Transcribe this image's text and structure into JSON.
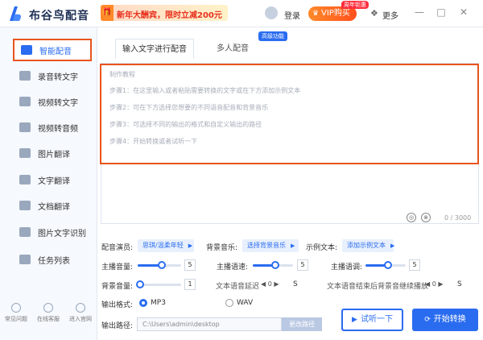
{
  "app": {
    "title": "布谷鸟配音",
    "promo_text": "新年大酬宾，限时立减200元",
    "login_label": "登录",
    "vip_label": "VIP购买",
    "vip_badge": "周年钜惠",
    "more_label": "更多",
    "window_controls": [
      "—",
      "□",
      "✕"
    ]
  },
  "sidebar": {
    "items": [
      {
        "label": "智能配音",
        "icon": "mic-icon",
        "active": true
      },
      {
        "label": "录音转文字",
        "icon": "recording-icon"
      },
      {
        "label": "视频转文字",
        "icon": "video-icon"
      },
      {
        "label": "视频转音频",
        "icon": "video-audio-icon"
      },
      {
        "label": "图片翻译",
        "icon": "image-icon"
      },
      {
        "label": "文字翻译",
        "icon": "translate-icon"
      },
      {
        "label": "文档翻译",
        "icon": "document-icon"
      },
      {
        "label": "图片文字识别",
        "icon": "ocr-icon"
      },
      {
        "label": "任务列表",
        "icon": "task-icon"
      }
    ],
    "footer": [
      {
        "label": "常见问题",
        "icon": "help-icon"
      },
      {
        "label": "在线客服",
        "icon": "support-icon"
      },
      {
        "label": "进入官网",
        "icon": "home-icon"
      }
    ]
  },
  "tabs": {
    "single": "输入文字进行配音",
    "multi": "多人配音",
    "multi_badge": "高级功能"
  },
  "editor": {
    "heading": "制作教程",
    "steps": [
      "步骤1：在这里输入或者粘贴需要转换的文字或在下方添加示例文本",
      "步骤2：可在下方选择您想要的不同语音配音和背景音乐",
      "步骤3：可选择不同的输出的格式和自定义输出的路径",
      "步骤4：开始转换或者试听一下"
    ],
    "counter": "0 / 3000"
  },
  "settings": {
    "voice_label": "配音演员:",
    "voice_value": "思琪/温柔年轻",
    "bgm_label": "背景音乐:",
    "bgm_value": "选择背景音乐",
    "sample_label": "示例文本:",
    "sample_value": "添加示例文本",
    "main_volume_label": "主播音量:",
    "main_volume_value": "5",
    "main_volume_level": 0.55,
    "main_speed_label": "主播语速:",
    "main_speed_value": "5",
    "main_speed_level": 0.55,
    "main_pitch_label": "主播语调:",
    "main_pitch_value": "5",
    "main_pitch_level": 0.55,
    "bg_volume_label": "背景音量:",
    "bg_volume_value": "1",
    "bg_volume_level": 0.05,
    "delay_label": "文本语音延迟",
    "delay_value": "0",
    "delay_unit": "S",
    "bg_continue_label": "文本语音结束后背景音继续播放",
    "bg_continue_value": "0",
    "bg_continue_unit": "S",
    "format_label": "输出格式:",
    "format_options": [
      "MP3",
      "WAV"
    ],
    "format_selected": "MP3",
    "path_label": "输出路径:",
    "path_value": "C:\\Users\\admin\\desktop",
    "path_button": "更改路径"
  },
  "actions": {
    "listen": "试听一下",
    "start": "开始转换"
  },
  "colors": {
    "accent": "#2a6cf0",
    "highlight": "#e8541e",
    "promo_red": "#e8311e"
  }
}
